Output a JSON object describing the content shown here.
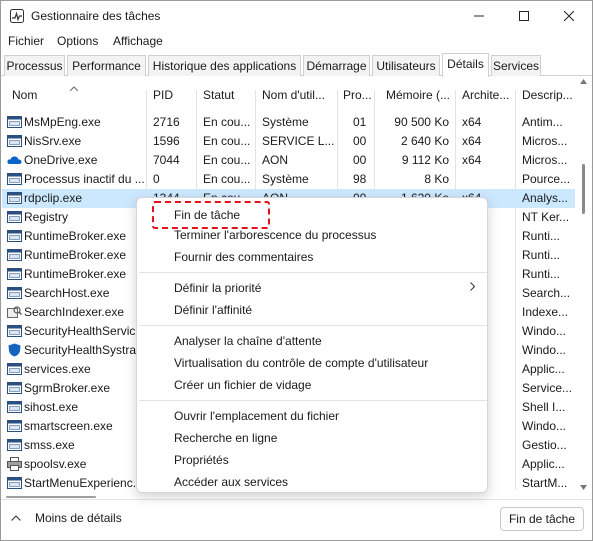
{
  "window": {
    "title": "Gestionnaire des tâches"
  },
  "menubar": [
    "Fichier",
    "Options",
    "Affichage"
  ],
  "tabs": [
    "Processus",
    "Performance",
    "Historique des applications",
    "Démarrage",
    "Utilisateurs",
    "Détails",
    "Services"
  ],
  "active_tab": "Détails",
  "columns": [
    "Nom",
    "PID",
    "Statut",
    "Nom d'util...",
    "Pro...",
    "Mémoire (...",
    "Archite...",
    "Descrip..."
  ],
  "rows": [
    {
      "icon": "window-app-icon",
      "name": "MsMpEng.exe",
      "pid": "2716",
      "status": "En cou...",
      "user": "Système",
      "cpu": "01",
      "memory": "90 500 Ko",
      "arch": "x64",
      "desc": "Antim..."
    },
    {
      "icon": "window-app-icon",
      "name": "NisSrv.exe",
      "pid": "1596",
      "status": "En cou...",
      "user": "SERVICE L...",
      "cpu": "00",
      "memory": "2 640 Ko",
      "arch": "x64",
      "desc": "Micros..."
    },
    {
      "icon": "onedrive-cloud-icon",
      "name": "OneDrive.exe",
      "pid": "7044",
      "status": "En cou...",
      "user": "AON",
      "cpu": "00",
      "memory": "9 112 Ko",
      "arch": "x64",
      "desc": "Micros..."
    },
    {
      "icon": "window-app-icon",
      "name": "Processus inactif du ...",
      "pid": "0",
      "status": "En cou...",
      "user": "Système",
      "cpu": "98",
      "memory": "8 Ko",
      "arch": "",
      "desc": "Pource..."
    },
    {
      "icon": "window-app-icon",
      "name": "rdpclip.exe",
      "pid": "1344",
      "status": "En cou...",
      "user": "AON",
      "cpu": "00",
      "memory": "1 620 Ko",
      "arch": "x64",
      "desc": "Analys..."
    },
    {
      "icon": "window-app-icon",
      "name": "Registry",
      "pid": "",
      "status": "",
      "user": "",
      "cpu": "",
      "memory": "",
      "arch": "",
      "desc": "NT Ker..."
    },
    {
      "icon": "window-app-icon",
      "name": "RuntimeBroker.exe",
      "pid": "",
      "status": "",
      "user": "",
      "cpu": "",
      "memory": "",
      "arch": "",
      "desc": "Runti..."
    },
    {
      "icon": "window-app-icon",
      "name": "RuntimeBroker.exe",
      "pid": "",
      "status": "",
      "user": "",
      "cpu": "",
      "memory": "",
      "arch": "",
      "desc": "Runti..."
    },
    {
      "icon": "window-app-icon",
      "name": "RuntimeBroker.exe",
      "pid": "",
      "status": "",
      "user": "",
      "cpu": "",
      "memory": "",
      "arch": "",
      "desc": "Runti..."
    },
    {
      "icon": "window-app-icon",
      "name": "SearchHost.exe",
      "pid": "",
      "status": "",
      "user": "",
      "cpu": "",
      "memory": "",
      "arch": "",
      "desc": "Search..."
    },
    {
      "icon": "search-indexer-icon",
      "name": "SearchIndexer.exe",
      "pid": "",
      "status": "",
      "user": "",
      "cpu": "",
      "memory": "",
      "arch": "",
      "desc": "Indexe..."
    },
    {
      "icon": "window-app-icon",
      "name": "SecurityHealthServic...",
      "pid": "",
      "status": "",
      "user": "",
      "cpu": "",
      "memory": "",
      "arch": "",
      "desc": "Windo..."
    },
    {
      "icon": "shield-icon",
      "name": "SecurityHealthSystra...",
      "pid": "",
      "status": "",
      "user": "",
      "cpu": "",
      "memory": "",
      "arch": "",
      "desc": "Windo..."
    },
    {
      "icon": "window-app-icon",
      "name": "services.exe",
      "pid": "",
      "status": "",
      "user": "",
      "cpu": "",
      "memory": "",
      "arch": "",
      "desc": "Applic..."
    },
    {
      "icon": "window-app-icon",
      "name": "SgrmBroker.exe",
      "pid": "",
      "status": "",
      "user": "",
      "cpu": "",
      "memory": "",
      "arch": "",
      "desc": "Service..."
    },
    {
      "icon": "window-app-icon",
      "name": "sihost.exe",
      "pid": "",
      "status": "",
      "user": "",
      "cpu": "",
      "memory": "",
      "arch": "",
      "desc": "Shell I..."
    },
    {
      "icon": "window-app-icon",
      "name": "smartscreen.exe",
      "pid": "",
      "status": "",
      "user": "",
      "cpu": "",
      "memory": "",
      "arch": "",
      "desc": "Windo..."
    },
    {
      "icon": "window-app-icon",
      "name": "smss.exe",
      "pid": "",
      "status": "",
      "user": "",
      "cpu": "",
      "memory": "",
      "arch": "",
      "desc": "Gestio..."
    },
    {
      "icon": "printer-icon",
      "name": "spoolsv.exe",
      "pid": "",
      "status": "",
      "user": "",
      "cpu": "",
      "memory": "",
      "arch": "",
      "desc": "Applic..."
    },
    {
      "icon": "window-app-icon",
      "name": "StartMenuExperienc...",
      "pid": "",
      "status": "",
      "user": "",
      "cpu": "",
      "memory": "",
      "arch": "",
      "desc": "StartM..."
    }
  ],
  "selected_row": 4,
  "context_menu": {
    "groups": [
      [
        "Fin de tâche",
        "Terminer l'arborescence du processus",
        "Fournir des commentaires"
      ],
      [
        "Définir la priorité",
        "Définir l'affinité"
      ],
      [
        "Analyser la chaîne d'attente",
        "Virtualisation du contrôle de compte d'utilisateur",
        "Créer un fichier de vidage"
      ],
      [
        "Ouvrir l'emplacement du fichier",
        "Recherche en ligne",
        "Propriétés",
        "Accéder aux services"
      ]
    ],
    "submenu_item": "Définir la priorité",
    "highlighted_item": "Fin de tâche"
  },
  "footer": {
    "less_details_label": "Moins de détails",
    "end_task_label": "Fin de tâche"
  },
  "colors": {
    "selected_row": "#cce8ff",
    "highlight_border": "#e0141a",
    "onedrive_blue": "#0a64c8",
    "shield_blue": "#1565c0"
  }
}
